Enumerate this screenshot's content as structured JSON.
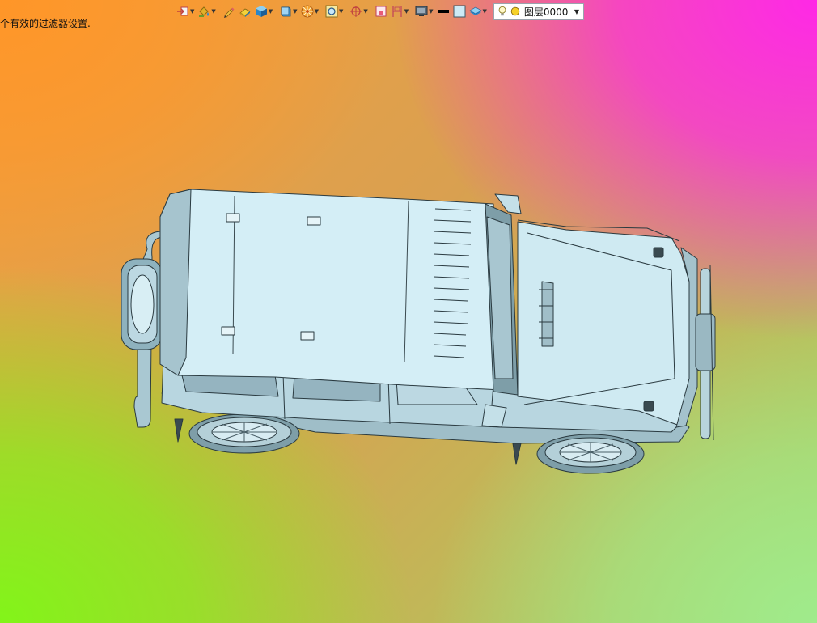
{
  "status": {
    "message": "个有效的过滤器设置."
  },
  "toolbar": {
    "buttons": [
      {
        "name": "move-object-icon",
        "dropdown": true
      },
      {
        "name": "paint-bucket-icon",
        "dropdown": true
      },
      {
        "name": "pencil-icon",
        "dropdown": false
      },
      {
        "name": "eraser-icon",
        "dropdown": false
      },
      {
        "name": "cube-shaded-icon",
        "dropdown": true
      },
      {
        "name": "cube-view-icon",
        "dropdown": true
      },
      {
        "name": "color-wheel-icon",
        "dropdown": true
      },
      {
        "name": "zoom-fit-icon",
        "dropdown": true
      },
      {
        "name": "rotate-icon",
        "dropdown": true
      },
      {
        "name": "section-view-icon",
        "dropdown": false
      },
      {
        "name": "clip-plane-icon",
        "dropdown": true
      },
      {
        "name": "monitor-display-icon",
        "dropdown": true
      },
      {
        "name": "line-color-icon",
        "dropdown": false
      },
      {
        "name": "fill-color-icon",
        "dropdown": false
      },
      {
        "name": "layer-stack-icon",
        "dropdown": true
      }
    ],
    "layer_select": {
      "value": "图层0000"
    }
  },
  "colors": {
    "accent_top_right": "#ff28e6",
    "accent_top_left": "#ff9628",
    "accent_bottom_left": "#82f519",
    "model_face": "#cdeaf2",
    "model_edge": "#2a3a40"
  }
}
